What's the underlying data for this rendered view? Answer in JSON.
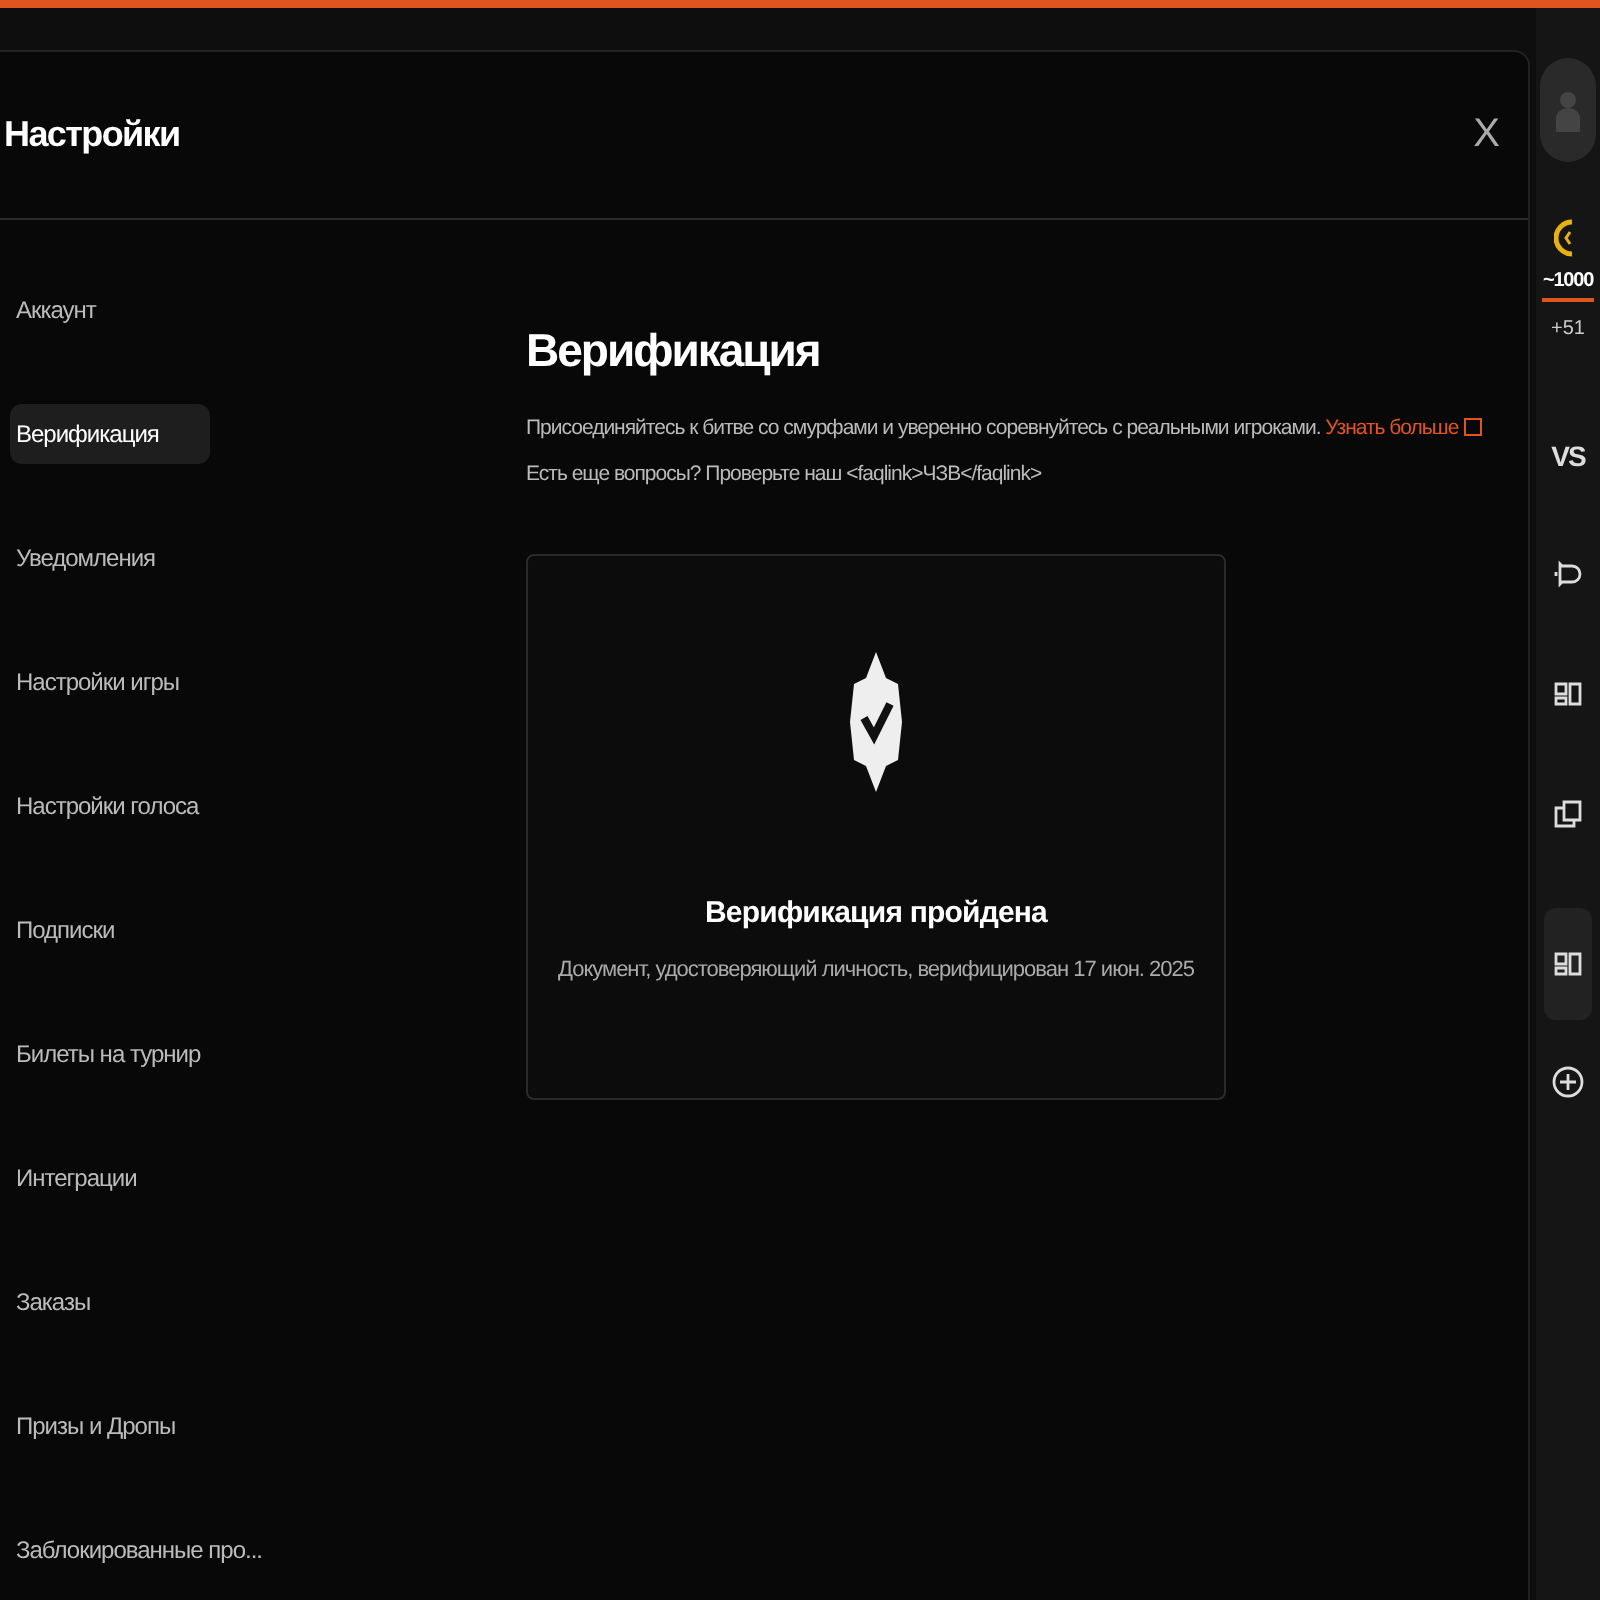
{
  "window": {
    "title": "Настройки",
    "close": "X"
  },
  "sidebar": {
    "items": [
      {
        "label": "Аккаунт",
        "selected": false
      },
      {
        "label": "Верификация",
        "selected": true
      },
      {
        "label": "Уведомления",
        "selected": false
      },
      {
        "label": "Настройки игры",
        "selected": false
      },
      {
        "label": "Настройки голоса",
        "selected": false
      },
      {
        "label": "Подписки",
        "selected": false
      },
      {
        "label": "Билеты на турнир",
        "selected": false
      },
      {
        "label": "Интеграции",
        "selected": false
      },
      {
        "label": "Заказы",
        "selected": false
      },
      {
        "label": "Призы и Дропы",
        "selected": false
      },
      {
        "label": "Заблокированные про...",
        "selected": false
      }
    ]
  },
  "content": {
    "heading": "Верификация",
    "description": "Присоединяйтесь к битве со смурфами и уверенно соревнуйтесь с реальными игроками.",
    "link": "Узнать больше",
    "faq": "Есть еще вопросы? Проверьте наш <faqlink>ЧЗВ</faqlink>"
  },
  "status_card": {
    "title": "Верификация пройдена",
    "detail": "Документ, удостоверяющий личность, верифицирован 17 июн. 2025"
  },
  "rail": {
    "points": "~1000",
    "delta": "+51",
    "vs": "VS",
    "items": [
      {
        "kind": "bell",
        "selected": false
      },
      {
        "kind": "cards",
        "selected": false
      },
      {
        "kind": "screens",
        "selected": false
      },
      {
        "kind": "cards",
        "selected": true
      },
      {
        "kind": "add",
        "selected": false
      }
    ]
  }
}
